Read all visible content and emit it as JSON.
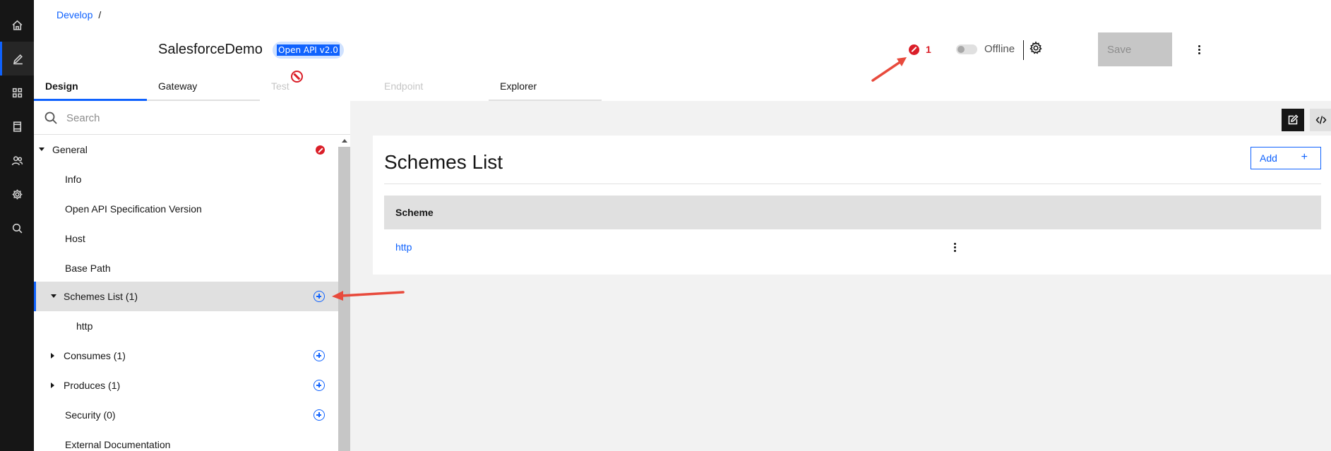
{
  "breadcrumb": {
    "root": "Develop",
    "separator": "/"
  },
  "header": {
    "api_title": "SalesforceDemo",
    "api_tag": "Open API v2.0",
    "error_count": "1",
    "status_label": "Offline",
    "save_label": "Save"
  },
  "tabs": [
    {
      "label": "Design",
      "state": "active"
    },
    {
      "label": "Gateway",
      "state": "enabled"
    },
    {
      "label": "Test",
      "state": "disabled"
    },
    {
      "label": "Endpoint",
      "state": "disabled"
    },
    {
      "label": "Explorer",
      "state": "enabled"
    }
  ],
  "search": {
    "placeholder": "Search"
  },
  "tree": [
    {
      "label": "General",
      "expanded": true,
      "error": true
    },
    {
      "label": "Info"
    },
    {
      "label": "Open API Specification Version"
    },
    {
      "label": "Host"
    },
    {
      "label": "Base Path"
    },
    {
      "label": "Schemes List (1)",
      "expanded": true,
      "selected": true,
      "addable": true
    },
    {
      "label": "http"
    },
    {
      "label": "Consumes (1)",
      "expanded": false,
      "addable": true
    },
    {
      "label": "Produces (1)",
      "expanded": false,
      "addable": true
    },
    {
      "label": "Security (0)",
      "addable": true
    },
    {
      "label": "External Documentation"
    }
  ],
  "main": {
    "title": "Schemes List",
    "add_label": "Add",
    "add_plus": "+",
    "table": {
      "columns": [
        "Scheme"
      ],
      "rows": [
        [
          "http"
        ]
      ]
    }
  },
  "colors": {
    "accent": "#0f62fe",
    "error": "#da1e28",
    "annotation": "#e84a3c"
  }
}
